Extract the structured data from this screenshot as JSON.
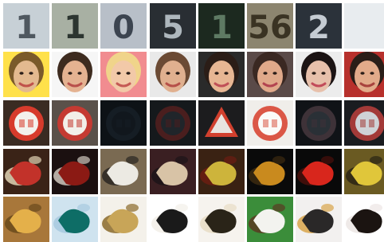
{
  "image_grid": {
    "title": "",
    "rows": [
      {
        "name": "house-number-digits",
        "cells": [
          {
            "kind": "digit",
            "bg": "#c7d0d6",
            "fg": "#4f5860",
            "text": "1"
          },
          {
            "kind": "digit",
            "bg": "#a8b0a4",
            "fg": "#2c3530",
            "text": "1"
          },
          {
            "kind": "digit",
            "bg": "#b8bfc8",
            "fg": "#3c4450",
            "text": "0"
          },
          {
            "kind": "digit",
            "bg": "#2a2f33",
            "fg": "#aeb7bd",
            "text": "5"
          },
          {
            "kind": "digit",
            "bg": "#1d2a1f",
            "fg": "#5e7a63",
            "text": "1"
          },
          {
            "kind": "digit",
            "bg": "#8c866f",
            "fg": "#3a3323",
            "text": "56"
          },
          {
            "kind": "digit",
            "bg": "#2c323a",
            "fg": "#c5ccd3",
            "text": "2"
          },
          {
            "kind": "digit",
            "bg": "#e8ecef",
            "fg": "#d6dbdf",
            "text": ""
          }
        ]
      },
      {
        "name": "celebrity-faces",
        "cells": [
          {
            "kind": "face",
            "bg": "#ffe14a",
            "fg": "#e3b98f",
            "hair": "#7a5a2a",
            "mouth": "#c0524a"
          },
          {
            "kind": "face",
            "bg": "#f6f6f6",
            "fg": "#e4b291",
            "hair": "#3d2b1f",
            "mouth": "#b9504b"
          },
          {
            "kind": "face",
            "bg": "#f18c90",
            "fg": "#f2c9a8",
            "hair": "#f0d48a",
            "mouth": "#c55a55"
          },
          {
            "kind": "face",
            "bg": "#e9e9e9",
            "fg": "#e0b08f",
            "hair": "#6b4a34",
            "mouth": "#b65049"
          },
          {
            "kind": "face",
            "bg": "#2a2a2a",
            "fg": "#e7b693",
            "hair": "#2b1d17",
            "mouth": "#c05057"
          },
          {
            "kind": "face",
            "bg": "#5a4a48",
            "fg": "#e0a98a",
            "hair": "#3a2822",
            "mouth": "#b34450"
          },
          {
            "kind": "face",
            "bg": "#ececec",
            "fg": "#e7c0ab",
            "hair": "#1c1414",
            "mouth": "#c24b5a"
          },
          {
            "kind": "face",
            "bg": "#b7302c",
            "fg": "#e2ab8a",
            "hair": "#2a1e18",
            "mouth": "#a8423d"
          }
        ]
      },
      {
        "name": "traffic-signs",
        "cells": [
          {
            "kind": "sign",
            "bg": "#3a2b22",
            "fg": "#f3f1ec",
            "ring": "#d73b2c",
            "shape": "circle"
          },
          {
            "kind": "sign",
            "bg": "#5a514a",
            "fg": "#f2efe9",
            "ring": "#c53a32",
            "shape": "circle"
          },
          {
            "kind": "sign",
            "bg": "#0d1216",
            "fg": "#11171d",
            "ring": "#151d24",
            "shape": "circle"
          },
          {
            "kind": "sign",
            "bg": "#15191c",
            "fg": "#20252a",
            "ring": "#4a1e1e",
            "shape": "circle"
          },
          {
            "kind": "sign",
            "bg": "#1c1c1e",
            "fg": "#e8e4df",
            "ring": "#d1402e",
            "shape": "triangle"
          },
          {
            "kind": "sign",
            "bg": "#f0eeea",
            "fg": "#fbfaf8",
            "ring": "#db5746",
            "shape": "circle"
          },
          {
            "kind": "sign",
            "bg": "#101317",
            "fg": "#2a3036",
            "ring": "#3e3238",
            "shape": "circle"
          },
          {
            "kind": "sign",
            "bg": "#1a1c20",
            "fg": "#cfd2d6",
            "ring": "#a33a38",
            "shape": "circle"
          }
        ]
      },
      {
        "name": "generated-scenes-a",
        "cells": [
          {
            "kind": "blob",
            "bg": "#3a2317",
            "fg": "#c2322a",
            "acc": "#e1d3b5"
          },
          {
            "kind": "blob",
            "bg": "#1b1010",
            "fg": "#8b1a14",
            "acc": "#cfc7bd"
          },
          {
            "kind": "blob",
            "bg": "#7a6a52",
            "fg": "#eceae3",
            "acc": "#2a2622"
          },
          {
            "kind": "blob",
            "bg": "#3a1f22",
            "fg": "#d8c3a6",
            "acc": "#1c1418"
          },
          {
            "kind": "blob",
            "bg": "#3a2213",
            "fg": "#cdb43b",
            "acc": "#6c1d12"
          },
          {
            "kind": "blob",
            "bg": "#0a0a0a",
            "fg": "#c98a1e",
            "acc": "#3c2a10"
          },
          {
            "kind": "blob",
            "bg": "#090909",
            "fg": "#d8261c",
            "acc": "#4a0f0b"
          },
          {
            "kind": "blob",
            "bg": "#6a5a22",
            "fg": "#e0c63a",
            "acc": "#2a2414"
          }
        ]
      },
      {
        "name": "generated-scenes-b",
        "cells": [
          {
            "kind": "blob",
            "bg": "#a8773a",
            "fg": "#e4b04a",
            "acc": "#6a4a1c"
          },
          {
            "kind": "blob",
            "bg": "#cfe3ef",
            "fg": "#0e6d66",
            "acc": "#a7c9df"
          },
          {
            "kind": "blob",
            "bg": "#f4f1ea",
            "fg": "#c8a558",
            "acc": "#8a6a2a"
          },
          {
            "kind": "blob",
            "bg": "#ffffff",
            "fg": "#1a1a1a",
            "acc": "#f2efe8"
          },
          {
            "kind": "blob",
            "bg": "#f6f3ee",
            "fg": "#2a2418",
            "acc": "#e8dcc4"
          },
          {
            "kind": "blob",
            "bg": "#3b8d3a",
            "fg": "#f3f3ef",
            "acc": "#5a3a22"
          },
          {
            "kind": "blob",
            "bg": "#f2f0ef",
            "fg": "#2a2828",
            "acc": "#d9a44a"
          },
          {
            "kind": "blob",
            "bg": "#ffffff",
            "fg": "#1b1411",
            "acc": "#ece6e4"
          }
        ]
      }
    ]
  }
}
